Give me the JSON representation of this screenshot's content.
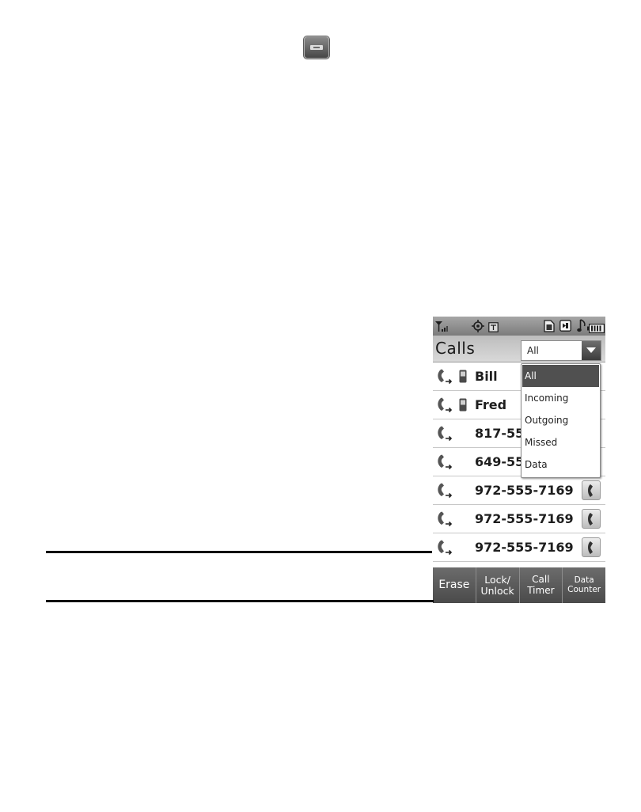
{
  "page": {
    "menu_key_icon": "menu-key-icon"
  },
  "phone": {
    "status_bar": {
      "icons": [
        "signal-icon",
        "gps-icon",
        "status-indicator-icon",
        "memory-card-icon",
        "status-box-icon",
        "music-icon",
        "battery-icon"
      ]
    },
    "header": {
      "title": "Calls",
      "filter_value": "All"
    },
    "calls": [
      {
        "label": "Bill",
        "icon": "outgoing-call-icon",
        "mobile_icon": true,
        "call_button": false
      },
      {
        "label": "Fred",
        "icon": "outgoing-call-icon",
        "mobile_icon": true,
        "call_button": false
      },
      {
        "label": "817-55",
        "icon": "outgoing-call-icon",
        "mobile_icon": false,
        "call_button": false
      },
      {
        "label": "649-55",
        "icon": "outgoing-call-icon",
        "mobile_icon": false,
        "call_button": false
      },
      {
        "label": "972-555-7169",
        "icon": "outgoing-call-icon",
        "mobile_icon": false,
        "call_button": true
      },
      {
        "label": "972-555-7169",
        "icon": "outgoing-call-icon",
        "mobile_icon": false,
        "call_button": true
      },
      {
        "label": "972-555-7169",
        "icon": "outgoing-call-icon",
        "mobile_icon": false,
        "call_button": true
      }
    ],
    "filter_menu": {
      "options": [
        "All",
        "Incoming",
        "Outgoing",
        "Missed",
        "Data"
      ],
      "selected_index": 0
    },
    "softkeys": [
      {
        "lines": [
          "Erase"
        ]
      },
      {
        "lines": [
          "Lock/",
          "Unlock"
        ]
      },
      {
        "lines": [
          "Call",
          "Timer"
        ]
      },
      {
        "lines": [
          "Data",
          "Counter"
        ]
      }
    ]
  },
  "colors": {
    "softkey_bar": "#4a4a4a",
    "menu_highlight": "#505050",
    "status_bar": "#7c7c7c"
  }
}
